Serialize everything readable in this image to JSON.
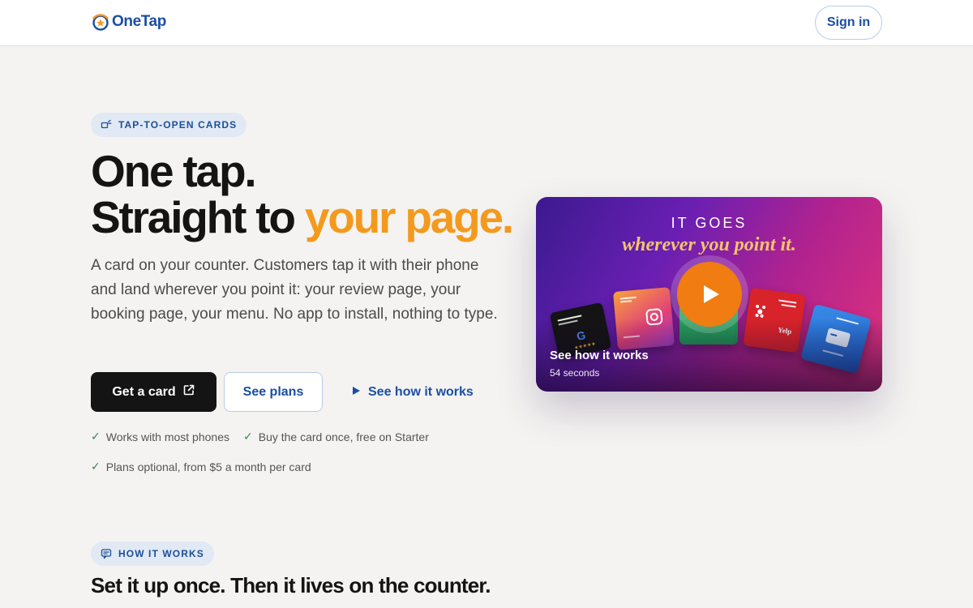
{
  "header": {
    "logo_text": "OneTap",
    "signin_label": "Sign in"
  },
  "hero": {
    "badge": "TAP-TO-OPEN CARDS",
    "title_line1": "One tap.",
    "title_line2_prefix": "Straight to ",
    "title_line2_accent": "your page.",
    "description": "A card on your counter. Customers tap it with their phone and land wherever you point it: your review page, your booking page, your menu. No app to install, nothing to type.",
    "primary_button": "Get a card",
    "secondary_button": "See plans",
    "link_button": "See how it works",
    "checks": [
      "Works with most phones",
      "Buy the card once, free on Starter",
      "Plans optional, from $5 a month per card"
    ]
  },
  "video": {
    "headline": "IT GOES",
    "script": "wherever you point it.",
    "caption": "See how it works",
    "duration": "54 seconds"
  },
  "how_it_works": {
    "badge": "HOW IT WORKS",
    "title": "Set it up once. Then it lives on the counter."
  },
  "colors": {
    "accent_orange": "#f39a1e",
    "brand_blue": "#1a4fa3",
    "dark_button": "#141414",
    "check_green": "#2f8a4e"
  },
  "icons": {
    "badge1": "tap-icon",
    "badge2": "chat-icon",
    "primary_button": "external-link-icon",
    "link_button": "play-triangle-icon",
    "check": "check-icon",
    "video": "play-icon"
  }
}
